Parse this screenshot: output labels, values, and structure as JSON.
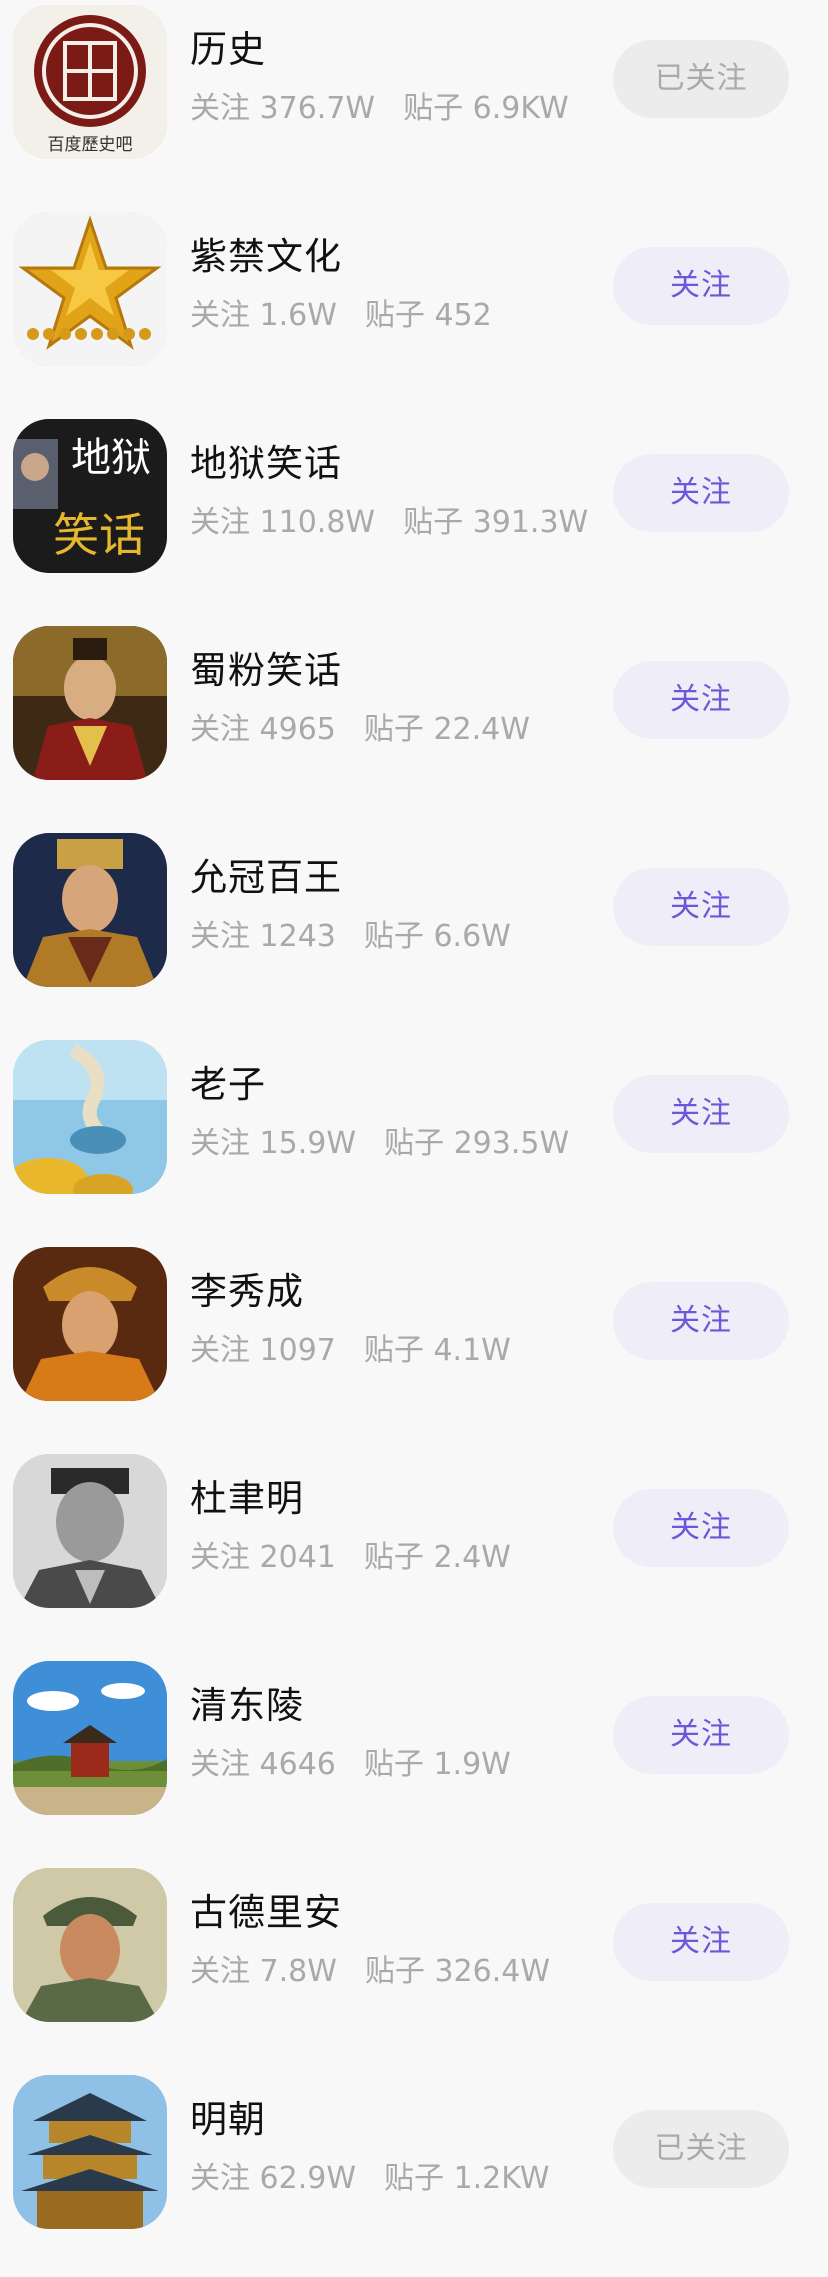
{
  "forums": [
    {
      "name": "历史",
      "follow_label": "关注",
      "follow_count": "376.7W",
      "post_label": "贴子",
      "post_count": "6.9KW",
      "button": "已关注",
      "followed": true,
      "avatar_text": "百度歷史吧"
    },
    {
      "name": "紫禁文化",
      "follow_label": "关注",
      "follow_count": "1.6W",
      "post_label": "贴子",
      "post_count": "452",
      "button": "关注",
      "followed": false
    },
    {
      "name": "地狱笑话",
      "follow_label": "关注",
      "follow_count": "110.8W",
      "post_label": "贴子",
      "post_count": "391.3W",
      "button": "关注",
      "followed": false,
      "avatar_text_top": "地狱",
      "avatar_text_bottom": "笑话"
    },
    {
      "name": "蜀粉笑话",
      "follow_label": "关注",
      "follow_count": "4965",
      "post_label": "贴子",
      "post_count": "22.4W",
      "button": "关注",
      "followed": false
    },
    {
      "name": "允冠百王",
      "follow_label": "关注",
      "follow_count": "1243",
      "post_label": "贴子",
      "post_count": "6.6W",
      "button": "关注",
      "followed": false
    },
    {
      "name": "老子",
      "follow_label": "关注",
      "follow_count": "15.9W",
      "post_label": "贴子",
      "post_count": "293.5W",
      "button": "关注",
      "followed": false
    },
    {
      "name": "李秀成",
      "follow_label": "关注",
      "follow_count": "1097",
      "post_label": "贴子",
      "post_count": "4.1W",
      "button": "关注",
      "followed": false
    },
    {
      "name": "杜聿明",
      "follow_label": "关注",
      "follow_count": "2041",
      "post_label": "贴子",
      "post_count": "2.4W",
      "button": "关注",
      "followed": false
    },
    {
      "name": "清东陵",
      "follow_label": "关注",
      "follow_count": "4646",
      "post_label": "贴子",
      "post_count": "1.9W",
      "button": "关注",
      "followed": false
    },
    {
      "name": "古德里安",
      "follow_label": "关注",
      "follow_count": "7.8W",
      "post_label": "贴子",
      "post_count": "326.4W",
      "button": "关注",
      "followed": false
    },
    {
      "name": "明朝",
      "follow_label": "关注",
      "follow_count": "62.9W",
      "post_label": "贴子",
      "post_count": "1.2KW",
      "button": "已关注",
      "followed": true
    }
  ],
  "colors": {
    "accent": "#6b58d8",
    "button_bg": "#efedf8",
    "followed_bg": "#ececec",
    "followed_text": "#aaaaaa",
    "meta_text": "#a9a9a9"
  }
}
